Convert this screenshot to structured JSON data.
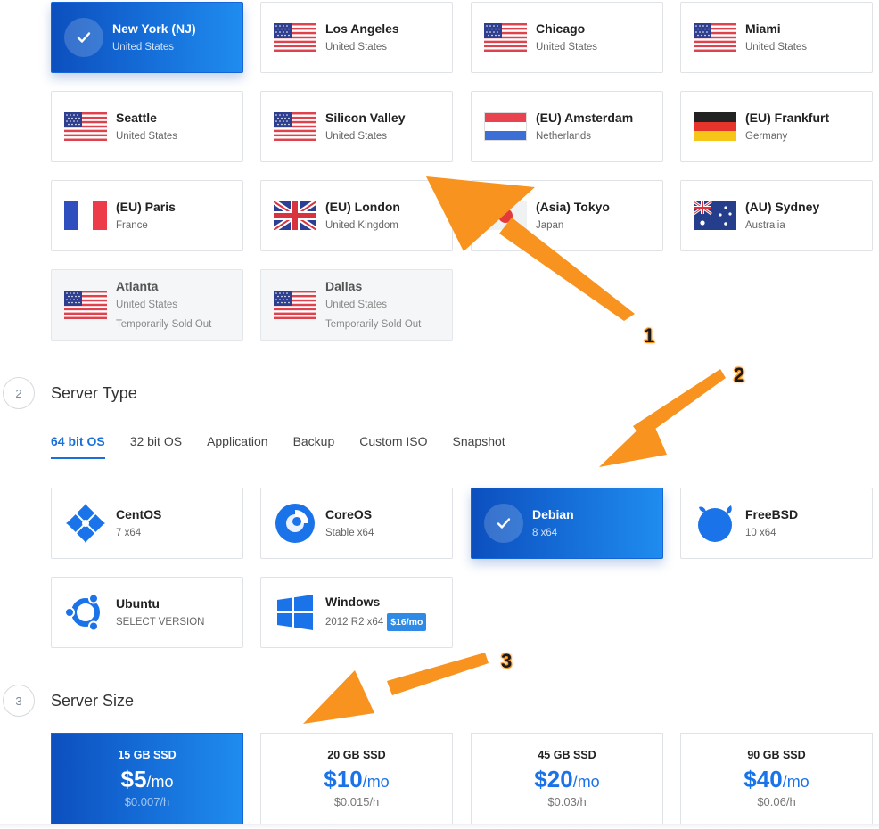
{
  "locations": [
    {
      "name": "New York (NJ)",
      "country": "United States",
      "flag": "check",
      "selected": true,
      "note": ""
    },
    {
      "name": "Los Angeles",
      "country": "United States",
      "flag": "us"
    },
    {
      "name": "Chicago",
      "country": "United States",
      "flag": "us"
    },
    {
      "name": "Miami",
      "country": "United States",
      "flag": "us"
    },
    {
      "name": "Seattle",
      "country": "United States",
      "flag": "us"
    },
    {
      "name": "Silicon Valley",
      "country": "United States",
      "flag": "us"
    },
    {
      "name": "(EU) Amsterdam",
      "country": "Netherlands",
      "flag": "nl"
    },
    {
      "name": "(EU) Frankfurt",
      "country": "Germany",
      "flag": "de"
    },
    {
      "name": "(EU) Paris",
      "country": "France",
      "flag": "fr"
    },
    {
      "name": "(EU) London",
      "country": "United Kingdom",
      "flag": "uk"
    },
    {
      "name": "(Asia) Tokyo",
      "country": "Japan",
      "flag": "jp"
    },
    {
      "name": "(AU) Sydney",
      "country": "Australia",
      "flag": "au"
    },
    {
      "name": "Atlanta",
      "country": "United States",
      "flag": "us",
      "note": "Temporarily Sold Out"
    },
    {
      "name": "Dallas",
      "country": "United States",
      "flag": "us",
      "note": "Temporarily Sold Out"
    }
  ],
  "server_type": {
    "step": "2",
    "title": "Server Type",
    "tabs": [
      "64 bit OS",
      "32 bit OS",
      "Application",
      "Backup",
      "Custom ISO",
      "Snapshot"
    ],
    "active_tab": "64 bit OS",
    "os": [
      {
        "name": "CentOS",
        "version": "7  x64",
        "icon": "centos-icon"
      },
      {
        "name": "CoreOS",
        "version": "Stable  x64",
        "icon": "coreos-icon"
      },
      {
        "name": "Debian",
        "version": "8  x64",
        "icon": "check",
        "selected": true
      },
      {
        "name": "FreeBSD",
        "version": "10  x64",
        "icon": "freebsd-icon"
      },
      {
        "name": "Ubuntu",
        "version": "SELECT VERSION",
        "icon": "ubuntu-icon"
      },
      {
        "name": "Windows",
        "version": "2012 R2  x64",
        "icon": "windows-icon",
        "badge": "$16/mo"
      }
    ]
  },
  "server_size": {
    "step": "3",
    "title": "Server Size",
    "plans": [
      {
        "storage": "15 GB SSD",
        "price": "$5",
        "per": "/mo",
        "hourly": "$0.007/h",
        "selected": true
      },
      {
        "storage": "20 GB SSD",
        "price": "$10",
        "per": "/mo",
        "hourly": "$0.015/h"
      },
      {
        "storage": "45 GB SSD",
        "price": "$20",
        "per": "/mo",
        "hourly": "$0.03/h"
      },
      {
        "storage": "90 GB SSD",
        "price": "$40",
        "per": "/mo",
        "hourly": "$0.06/h"
      }
    ]
  },
  "annotations": {
    "one": "1",
    "two": "2",
    "three": "3"
  },
  "colors": {
    "accent": "#1a6fd8",
    "arrow": "#f7931e",
    "selected_start": "#0c4fbf",
    "selected_end": "#1f8cf0"
  }
}
